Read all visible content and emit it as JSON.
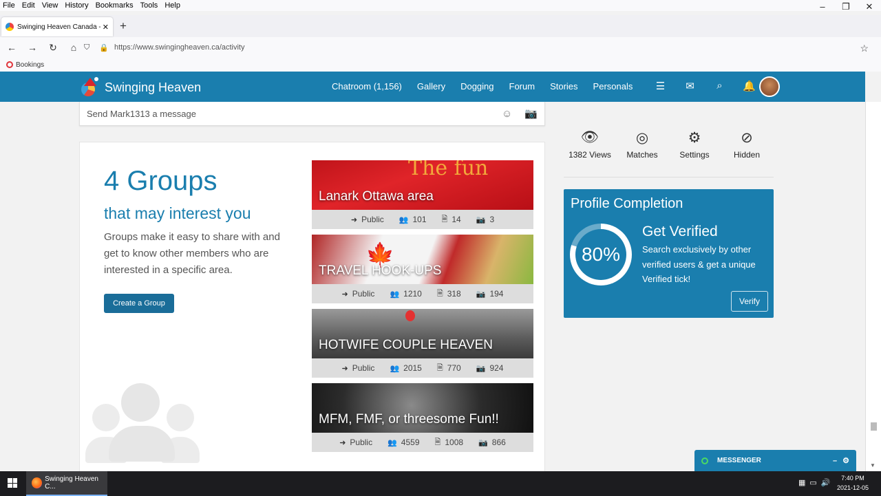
{
  "browser": {
    "menu": [
      "File",
      "Edit",
      "View",
      "History",
      "Bookmarks",
      "Tools",
      "Help"
    ],
    "window_controls": [
      "–",
      "❐",
      "✕"
    ],
    "tab_title": "Swinging Heaven Canada - Mes",
    "tab_close": "✕",
    "new_tab": "+",
    "url": "https://www.swingingheaven.ca/activity",
    "bookmark": "Bookings",
    "nav_icons": {
      "back": "←",
      "forward": "→",
      "reload": "↻",
      "home": "⌂",
      "shield": "⛉",
      "lock": "🔒",
      "star": "☆"
    }
  },
  "site": {
    "logo": "Swinging Heaven",
    "nav": [
      "Chatroom (1,156)",
      "Gallery",
      "Dogging",
      "Forum",
      "Stories",
      "Personals"
    ],
    "header_icons": {
      "menu": "☰",
      "mail": "✉",
      "search": "⌕",
      "bell": "🔔"
    }
  },
  "message_box": {
    "placeholder": "Send Mark1313 a message",
    "emoji_icon": "☺",
    "camera_icon": "📷"
  },
  "groups": {
    "title": "4 Groups",
    "subtitle": "that may interest you",
    "description": "Groups make it easy to share with and get to know other members who are interested in a specific area.",
    "create_button": "Create a Group",
    "items": [
      {
        "name": "Lanark Ottawa area",
        "visibility": "Public",
        "members": "101",
        "posts": "14",
        "photos": "3"
      },
      {
        "name": "TRAVEL HOOK-UPS",
        "visibility": "Public",
        "members": "1210",
        "posts": "318",
        "photos": "194"
      },
      {
        "name": "HOTWIFE COUPLE HEAVEN",
        "visibility": "Public",
        "members": "2015",
        "posts": "770",
        "photos": "924"
      },
      {
        "name": "MFM, FMF, or threesome Fun!!",
        "visibility": "Public",
        "members": "4559",
        "posts": "1008",
        "photos": "866"
      }
    ],
    "image_deco": {
      "first": "The fun",
      "leaf": "🍁"
    },
    "stat_icons": {
      "visibility": "➜",
      "members": "👥",
      "posts": "🗎",
      "photos": "📷"
    }
  },
  "sidebar": {
    "items": [
      {
        "label": "1382 Views",
        "icon": "👁"
      },
      {
        "label": "Matches",
        "icon": "◎"
      },
      {
        "label": "Settings",
        "icon": "⚙"
      },
      {
        "label": "Hidden",
        "icon": "⊘"
      }
    ]
  },
  "profile": {
    "title": "Profile Completion",
    "percent": "80%",
    "completion_fraction": 0.8,
    "heading": "Get Verified",
    "text": "Search exclusively by other verified users & get a unique Verified tick!",
    "button": "Verify"
  },
  "messenger": {
    "label": "MESSENGER",
    "minimize": "–",
    "settings": "⚙"
  },
  "taskbar": {
    "app": "Swinging Heaven C...",
    "time": "7:40 PM",
    "date": "2021-12-05",
    "tray_icons": [
      "▦",
      "▭",
      "🔊"
    ]
  },
  "colors": {
    "brand": "#1a7eae",
    "button": "#1a6d99",
    "online": "#4cd964"
  }
}
